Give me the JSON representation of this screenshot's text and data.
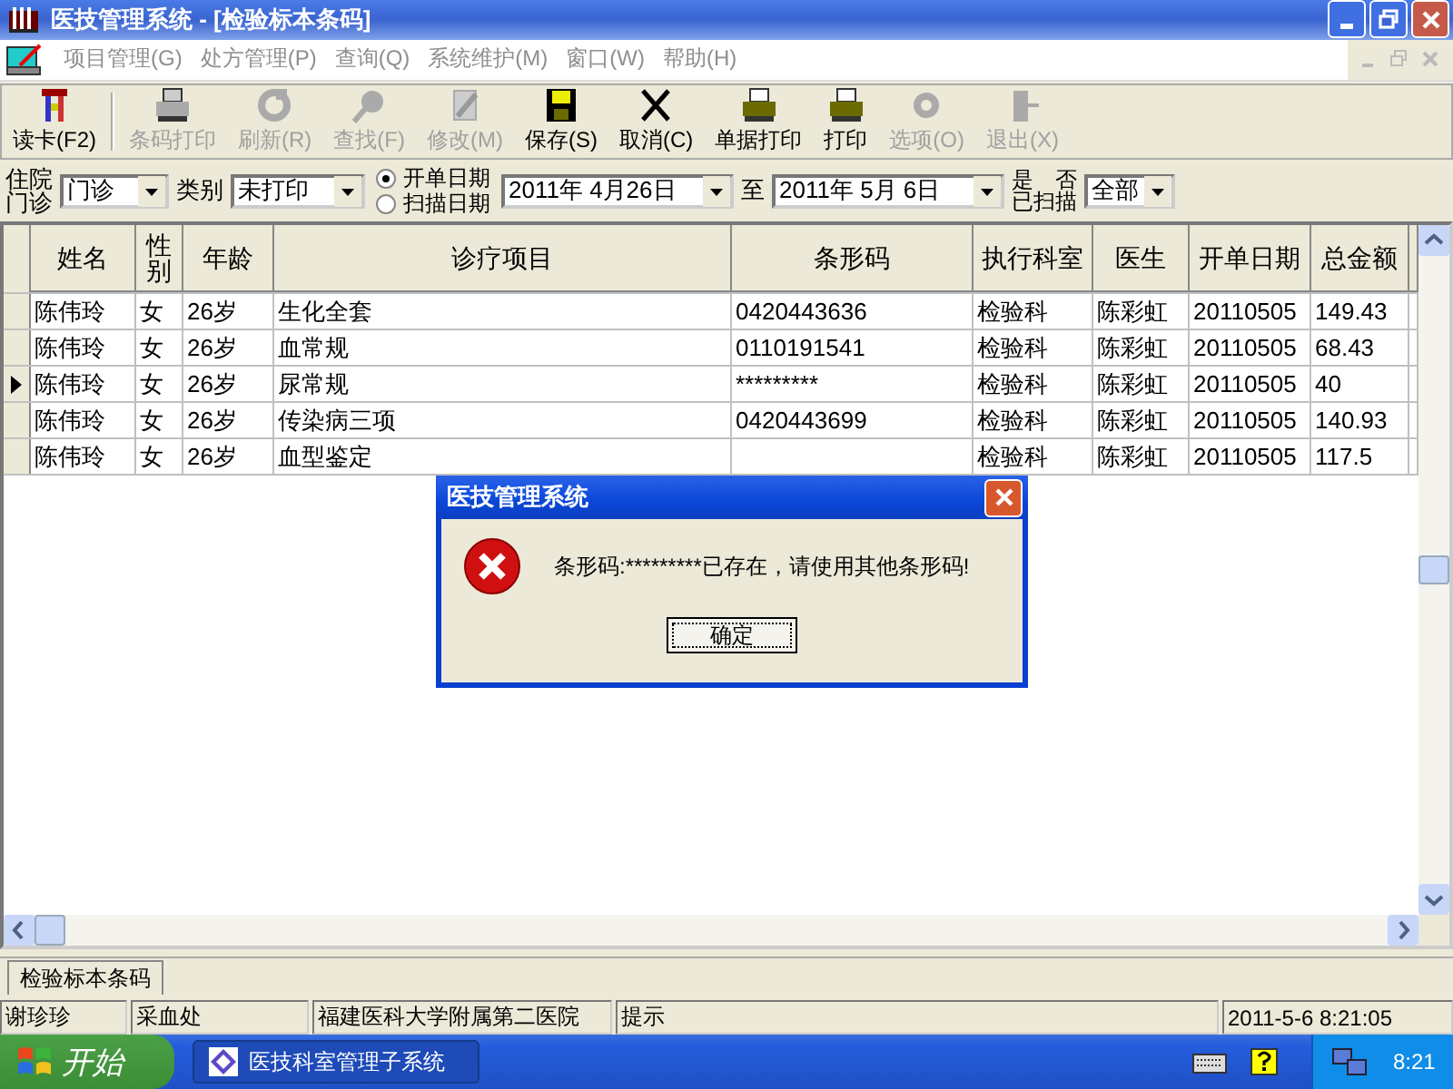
{
  "window": {
    "title": "医技管理系统 - [检验标本条码]"
  },
  "menu": [
    {
      "label": "项目管理(G)",
      "disabled": true
    },
    {
      "label": "处方管理(P)",
      "disabled": true
    },
    {
      "label": "查询(Q)",
      "disabled": true
    },
    {
      "label": "系统维护(M)",
      "disabled": true
    },
    {
      "label": "窗口(W)",
      "disabled": true
    },
    {
      "label": "帮助(H)",
      "disabled": true
    }
  ],
  "toolbar": [
    {
      "label": "读卡(F2)",
      "kind": "card",
      "disabled": false,
      "separator_after": true
    },
    {
      "label": "条码打印",
      "kind": "print",
      "disabled": true,
      "separator_after": false
    },
    {
      "label": "刷新(R)",
      "kind": "refresh",
      "disabled": true,
      "separator_after": false
    },
    {
      "label": "查找(F)",
      "kind": "search",
      "disabled": true,
      "separator_after": false
    },
    {
      "label": "修改(M)",
      "kind": "edit",
      "disabled": true,
      "separator_after": false
    },
    {
      "label": "保存(S)",
      "kind": "save",
      "disabled": false,
      "separator_after": false
    },
    {
      "label": "取消(C)",
      "kind": "cancel",
      "disabled": false,
      "separator_after": false
    },
    {
      "label": "单据打印",
      "kind": "print",
      "disabled": false,
      "separator_after": false
    },
    {
      "label": "打印",
      "kind": "print",
      "disabled": false,
      "separator_after": false
    },
    {
      "label": "选项(O)",
      "kind": "options",
      "disabled": true,
      "separator_after": false
    },
    {
      "label": "退出(X)",
      "kind": "exit",
      "disabled": true,
      "separator_after": false
    }
  ],
  "filter": {
    "source_label": "住院门诊",
    "source_value": "门诊",
    "category_label": "类别",
    "category_value": "未打印",
    "date_options": [
      {
        "label": "开单日期",
        "selected": true
      },
      {
        "label": "扫描日期",
        "selected": false
      }
    ],
    "date_from": "2011年 4月26日",
    "to_label": "至",
    "date_to": "2011年 5月 6日",
    "scan_yes": "是",
    "scan_no": "否",
    "scan_label": "已扫描",
    "scan_value": "全部"
  },
  "table": {
    "columns": [
      "姓名",
      "性别",
      "年龄",
      "诊疗项目",
      "条形码",
      "执行科室",
      "医生",
      "开单日期",
      "总金额"
    ],
    "rows": [
      {
        "selected": false,
        "cells": [
          "陈伟玲",
          "女",
          "26岁",
          "生化全套",
          "0420443636",
          "检验科",
          "陈彩虹",
          "20110505",
          "149.43"
        ]
      },
      {
        "selected": false,
        "cells": [
          "陈伟玲",
          "女",
          "26岁",
          "血常规",
          "0110191541",
          "检验科",
          "陈彩虹",
          "20110505",
          "68.43"
        ]
      },
      {
        "selected": true,
        "cells": [
          "陈伟玲",
          "女",
          "26岁",
          "尿常规",
          "*********",
          "检验科",
          "陈彩虹",
          "20110505",
          "40"
        ]
      },
      {
        "selected": false,
        "cells": [
          "陈伟玲",
          "女",
          "26岁",
          "传染病三项",
          "0420443699",
          "检验科",
          "陈彩虹",
          "20110505",
          "140.93"
        ]
      },
      {
        "selected": false,
        "cells": [
          "陈伟玲",
          "女",
          "26岁",
          "血型鉴定",
          "",
          "检验科",
          "陈彩虹",
          "20110505",
          "117.5"
        ]
      }
    ]
  },
  "dialog": {
    "title": "医技管理系统",
    "message": "条形码:*********已存在，请使用其他条形码!",
    "button": "确定"
  },
  "tabs": [
    {
      "label": "检验标本条码",
      "selected": true
    }
  ],
  "status_bar": [
    "谢珍珍",
    "采血处",
    "福建医科大学附属第二医院",
    "提示",
    "2011-5-6 8:21:05"
  ],
  "taskbar": {
    "start": "开始",
    "task": "医技科室管理子系统",
    "clock": "8:21"
  }
}
